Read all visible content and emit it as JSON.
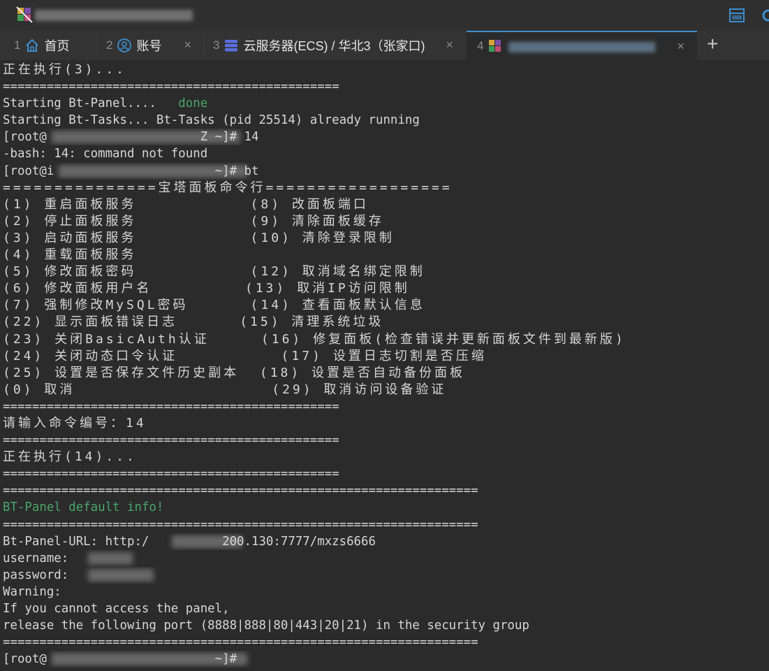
{
  "tabs": [
    {
      "num": "1",
      "label": "首页",
      "icon": "home-icon"
    },
    {
      "num": "2",
      "label": "账号",
      "icon": "user-icon"
    },
    {
      "num": "3",
      "label": "云服务器(ECS) / 华北3（张家口)",
      "icon": "server-icon"
    },
    {
      "num": "4",
      "label": "",
      "icon": "app-logo-icon"
    }
  ],
  "tab_close_glyph": "×",
  "new_tab_glyph": "+",
  "terminal": {
    "lines": [
      "正在执行(3)...",
      "==============================================",
      "Starting Bt-Panel....   ",
      "Starting Bt-Tasks... Bt-Tasks (pid 25514) already running",
      "[root@                     Z ~]# 14",
      "-bash: 14: command not found",
      "[root@i                      ~]# bt",
      "===============宝塔面板命令行==================",
      "(1) 重启面板服务           (8) 改面板端口",
      "(2) 停止面板服务           (9) 清除面板缓存",
      "(3) 启动面板服务           (10) 清除登录限制",
      "(4) 重载面板服务",
      "(5) 修改面板密码           (12) 取消域名绑定限制",
      "(6) 修改面板用户名         (13) 取消IP访问限制",
      "(7) 强制修改MySQL密码      (14) 查看面板默认信息",
      "(22) 显示面板错误日志      (15) 清理系统垃圾",
      "(23) 关闭BasicAuth认证     (16) 修复面板(检查错误并更新面板文件到最新版)",
      "(24) 关闭动态口令认证          (17) 设置日志切割是否压缩",
      "(25) 设置是否保存文件历史副本  (18) 设置是否自动备份面板",
      "(0) 取消                   (29) 取消访问设备验证",
      "==============================================",
      "请输入命令编号：14",
      "==============================================",
      "正在执行(14)...",
      "==============================================",
      "=================================================================",
      "BT-Panel default info!",
      "=================================================================",
      "Bt-Panel-URL: http:/          200.130:7777/mxzs6666",
      "username: ",
      "password: ",
      "Warning:",
      "If you cannot access the panel,",
      "release the following port (8888|888|80|443|20|21) in the security group",
      "=================================================================",
      "[root@                       ~]#"
    ],
    "done_text": "done"
  },
  "colors": {
    "background": "#2b2b2b",
    "text": "#d6d6d6",
    "green": "#4aa56a",
    "accent": "#3d8fd0"
  }
}
